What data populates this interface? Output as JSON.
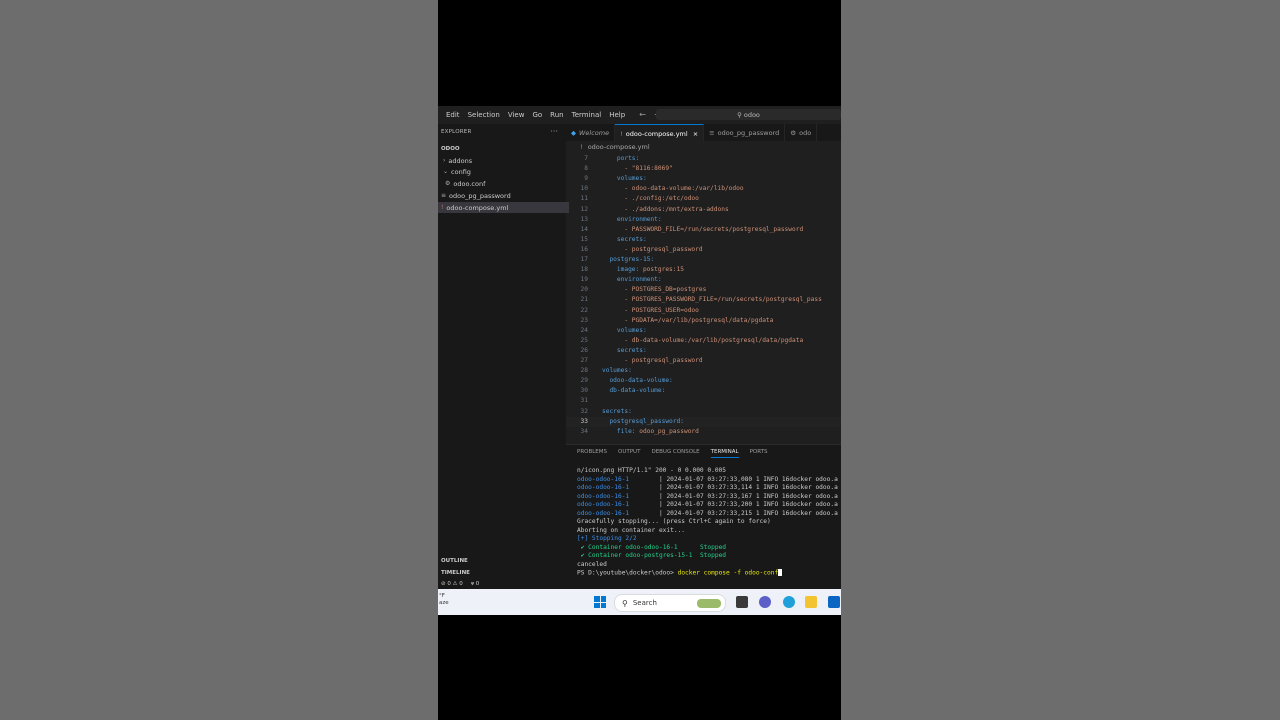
{
  "menu": [
    "Edit",
    "Selection",
    "View",
    "Go",
    "Run",
    "Terminal",
    "Help"
  ],
  "nav": {
    "back_icon": "arrow-left-icon",
    "forward_icon": "arrow-right-icon"
  },
  "command_center": {
    "text": "odoo",
    "icon": "search-icon"
  },
  "explorer": {
    "title": "EXPLORER",
    "folder": "ODOO",
    "items": [
      {
        "label": "addons",
        "icon": "chevron-right-icon"
      },
      {
        "label": "config",
        "icon": "chevron-down-icon"
      },
      {
        "label": "odoo.conf",
        "icon": "gear-icon"
      },
      {
        "label": "odoo_pg_password",
        "icon": "file-icon"
      },
      {
        "label": "odoo-compose.yml",
        "icon": "yaml-icon"
      }
    ],
    "outline": "OUTLINE",
    "timeline": "TIMELINE"
  },
  "tabs": [
    {
      "label": "Welcome",
      "icon": "vscode-icon"
    },
    {
      "label": "odoo-compose.yml",
      "icon": "yaml-icon",
      "close": "×"
    },
    {
      "label": "odoo_pg_password",
      "icon": "file-icon"
    },
    {
      "label": "odo",
      "icon": "gear-icon"
    }
  ],
  "breadcrumb": "odoo-compose.yml",
  "code": [
    {
      "n": "7",
      "indent": "    ",
      "key": "ports:",
      "val": ""
    },
    {
      "n": "8",
      "indent": "      ",
      "key": "",
      "val": "- \"8116:8069\""
    },
    {
      "n": "9",
      "indent": "    ",
      "key": "volumes:",
      "val": ""
    },
    {
      "n": "10",
      "indent": "      ",
      "key": "",
      "val": "- odoo-data-volume:/var/lib/odoo"
    },
    {
      "n": "11",
      "indent": "      ",
      "key": "",
      "val": "- ./config:/etc/odoo"
    },
    {
      "n": "12",
      "indent": "      ",
      "key": "",
      "val": "- ./addons:/mnt/extra-addons"
    },
    {
      "n": "13",
      "indent": "    ",
      "key": "environment:",
      "val": ""
    },
    {
      "n": "14",
      "indent": "      ",
      "key": "",
      "val": "- PASSWORD_FILE=/run/secrets/postgresql_password"
    },
    {
      "n": "15",
      "indent": "    ",
      "key": "secrets:",
      "val": ""
    },
    {
      "n": "16",
      "indent": "      ",
      "key": "",
      "val": "- postgresql_password"
    },
    {
      "n": "17",
      "indent": "  ",
      "key": "postgres-15:",
      "val": ""
    },
    {
      "n": "18",
      "indent": "    ",
      "key": "image: ",
      "val": "postgres:15"
    },
    {
      "n": "19",
      "indent": "    ",
      "key": "environment:",
      "val": ""
    },
    {
      "n": "20",
      "indent": "      ",
      "key": "",
      "val": "- POSTGRES_DB=postgres"
    },
    {
      "n": "21",
      "indent": "      ",
      "key": "",
      "val": "- POSTGRES_PASSWORD_FILE=/run/secrets/postgresql_pass"
    },
    {
      "n": "22",
      "indent": "      ",
      "key": "",
      "val": "- POSTGRES_USER=odoo"
    },
    {
      "n": "23",
      "indent": "      ",
      "key": "",
      "val": "- PGDATA=/var/lib/postgresql/data/pgdata"
    },
    {
      "n": "24",
      "indent": "    ",
      "key": "volumes:",
      "val": ""
    },
    {
      "n": "25",
      "indent": "      ",
      "key": "",
      "val": "- db-data-volume:/var/lib/postgresql/data/pgdata"
    },
    {
      "n": "26",
      "indent": "    ",
      "key": "secrets:",
      "val": ""
    },
    {
      "n": "27",
      "indent": "      ",
      "key": "",
      "val": "- postgresql_password"
    },
    {
      "n": "28",
      "indent": "",
      "key": "volumes:",
      "val": ""
    },
    {
      "n": "29",
      "indent": "  ",
      "key": "odoo-data-volume:",
      "val": ""
    },
    {
      "n": "30",
      "indent": "  ",
      "key": "db-data-volume:",
      "val": ""
    },
    {
      "n": "31",
      "indent": "",
      "key": "",
      "val": ""
    },
    {
      "n": "32",
      "indent": "",
      "key": "secrets:",
      "val": ""
    },
    {
      "n": "33",
      "indent": "  ",
      "key": "postgresql_password:",
      "val": ""
    },
    {
      "n": "34",
      "indent": "    ",
      "key": "file: ",
      "val": "odoo_pg_password"
    }
  ],
  "panel": {
    "tabs": [
      "PROBLEMS",
      "OUTPUT",
      "DEBUG CONSOLE",
      "TERMINAL",
      "PORTS"
    ],
    "active": "TERMINAL"
  },
  "terminal": {
    "line0": "n/icon.png HTTP/1.1\" 200 - 0 0.000 0.005",
    "log": [
      {
        "svc": "odoo-odoo-16-1",
        "msg": "| 2024-01-07 03:27:33,080 1 INFO 16docker odoo.a"
      },
      {
        "svc": "odoo-odoo-16-1",
        "msg": "| 2024-01-07 03:27:33,114 1 INFO 16docker odoo.a"
      },
      {
        "svc": "odoo-odoo-16-1",
        "msg": "| 2024-01-07 03:27:33,167 1 INFO 16docker odoo.a"
      },
      {
        "svc": "odoo-odoo-16-1",
        "msg": "| 2024-01-07 03:27:33,200 1 INFO 16docker odoo.a"
      },
      {
        "svc": "odoo-odoo-16-1",
        "msg": "| 2024-01-07 03:27:33,215 1 INFO 16docker odoo.a"
      }
    ],
    "stopping": "Gracefully stopping... (press Ctrl+C again to force)",
    "aborting": "Aborting on container exit...",
    "progress": "[+] Stopping 2/2",
    "containers": [
      {
        "name": "✔ Container odoo-odoo-16-1      ",
        "status": "Stopped"
      },
      {
        "name": "✔ Container odoo-postgres-15-1  ",
        "status": "Stopped"
      }
    ],
    "canceled": "canceled",
    "prompt": "PS D:\\youtube\\docker\\odoo> ",
    "command": "docker compose -f odoo-conf"
  },
  "status": {
    "errors": "⊘ 0 ⚠ 0",
    "ports": "ᴪ 0"
  },
  "taskbar": {
    "weather": "°F",
    "weather2": "aze",
    "search": "Search"
  },
  "colors": {
    "accent": "#0078d4",
    "editor_bg": "#1f1f1f",
    "sidebar_bg": "#181818"
  }
}
